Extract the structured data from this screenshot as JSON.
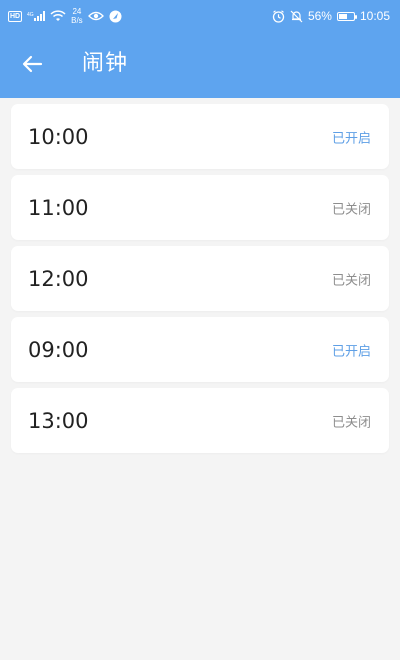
{
  "status_bar": {
    "hd": "HD",
    "signal_label": "4G",
    "speed_value": "24",
    "speed_unit": "B/s",
    "battery_percent_text": "56%",
    "battery_level": 0.56,
    "time": "10:05"
  },
  "header": {
    "title": "闹钟",
    "back_icon": "arrow-left-icon"
  },
  "alarms": [
    {
      "time": "10:00",
      "status": "已开启",
      "enabled": true
    },
    {
      "time": "11:00",
      "status": "已关闭",
      "enabled": false
    },
    {
      "time": "12:00",
      "status": "已关闭",
      "enabled": false
    },
    {
      "time": "09:00",
      "status": "已开启",
      "enabled": true
    },
    {
      "time": "13:00",
      "status": "已关闭",
      "enabled": false
    }
  ],
  "colors": {
    "header": "#5ea4ef",
    "background": "#f4f4f4",
    "card": "#ffffff",
    "enabled_text": "#5e9fe6",
    "disabled_text": "#8e8e8e"
  }
}
